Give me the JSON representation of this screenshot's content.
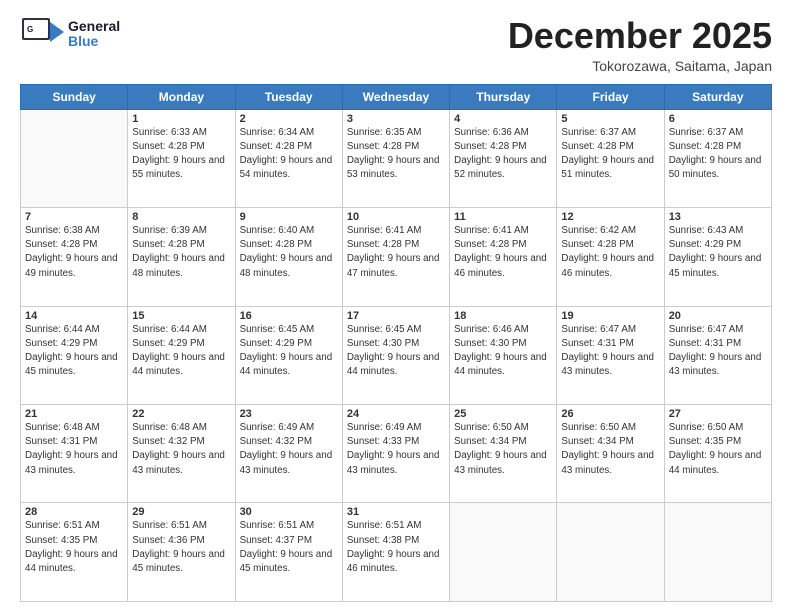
{
  "header": {
    "logo_general": "General",
    "logo_blue": "Blue",
    "month_title": "December 2025",
    "location": "Tokorozawa, Saitama, Japan"
  },
  "days_of_week": [
    "Sunday",
    "Monday",
    "Tuesday",
    "Wednesday",
    "Thursday",
    "Friday",
    "Saturday"
  ],
  "weeks": [
    [
      {
        "day": "",
        "empty": true
      },
      {
        "day": "1",
        "sunrise": "6:33 AM",
        "sunset": "4:28 PM",
        "daylight": "9 hours and 55 minutes."
      },
      {
        "day": "2",
        "sunrise": "6:34 AM",
        "sunset": "4:28 PM",
        "daylight": "9 hours and 54 minutes."
      },
      {
        "day": "3",
        "sunrise": "6:35 AM",
        "sunset": "4:28 PM",
        "daylight": "9 hours and 53 minutes."
      },
      {
        "day": "4",
        "sunrise": "6:36 AM",
        "sunset": "4:28 PM",
        "daylight": "9 hours and 52 minutes."
      },
      {
        "day": "5",
        "sunrise": "6:37 AM",
        "sunset": "4:28 PM",
        "daylight": "9 hours and 51 minutes."
      },
      {
        "day": "6",
        "sunrise": "6:37 AM",
        "sunset": "4:28 PM",
        "daylight": "9 hours and 50 minutes."
      }
    ],
    [
      {
        "day": "7",
        "sunrise": "6:38 AM",
        "sunset": "4:28 PM",
        "daylight": "9 hours and 49 minutes."
      },
      {
        "day": "8",
        "sunrise": "6:39 AM",
        "sunset": "4:28 PM",
        "daylight": "9 hours and 48 minutes."
      },
      {
        "day": "9",
        "sunrise": "6:40 AM",
        "sunset": "4:28 PM",
        "daylight": "9 hours and 48 minutes."
      },
      {
        "day": "10",
        "sunrise": "6:41 AM",
        "sunset": "4:28 PM",
        "daylight": "9 hours and 47 minutes."
      },
      {
        "day": "11",
        "sunrise": "6:41 AM",
        "sunset": "4:28 PM",
        "daylight": "9 hours and 46 minutes."
      },
      {
        "day": "12",
        "sunrise": "6:42 AM",
        "sunset": "4:28 PM",
        "daylight": "9 hours and 46 minutes."
      },
      {
        "day": "13",
        "sunrise": "6:43 AM",
        "sunset": "4:29 PM",
        "daylight": "9 hours and 45 minutes."
      }
    ],
    [
      {
        "day": "14",
        "sunrise": "6:44 AM",
        "sunset": "4:29 PM",
        "daylight": "9 hours and 45 minutes."
      },
      {
        "day": "15",
        "sunrise": "6:44 AM",
        "sunset": "4:29 PM",
        "daylight": "9 hours and 44 minutes."
      },
      {
        "day": "16",
        "sunrise": "6:45 AM",
        "sunset": "4:29 PM",
        "daylight": "9 hours and 44 minutes."
      },
      {
        "day": "17",
        "sunrise": "6:45 AM",
        "sunset": "4:30 PM",
        "daylight": "9 hours and 44 minutes."
      },
      {
        "day": "18",
        "sunrise": "6:46 AM",
        "sunset": "4:30 PM",
        "daylight": "9 hours and 44 minutes."
      },
      {
        "day": "19",
        "sunrise": "6:47 AM",
        "sunset": "4:31 PM",
        "daylight": "9 hours and 43 minutes."
      },
      {
        "day": "20",
        "sunrise": "6:47 AM",
        "sunset": "4:31 PM",
        "daylight": "9 hours and 43 minutes."
      }
    ],
    [
      {
        "day": "21",
        "sunrise": "6:48 AM",
        "sunset": "4:31 PM",
        "daylight": "9 hours and 43 minutes."
      },
      {
        "day": "22",
        "sunrise": "6:48 AM",
        "sunset": "4:32 PM",
        "daylight": "9 hours and 43 minutes."
      },
      {
        "day": "23",
        "sunrise": "6:49 AM",
        "sunset": "4:32 PM",
        "daylight": "9 hours and 43 minutes."
      },
      {
        "day": "24",
        "sunrise": "6:49 AM",
        "sunset": "4:33 PM",
        "daylight": "9 hours and 43 minutes."
      },
      {
        "day": "25",
        "sunrise": "6:50 AM",
        "sunset": "4:34 PM",
        "daylight": "9 hours and 43 minutes."
      },
      {
        "day": "26",
        "sunrise": "6:50 AM",
        "sunset": "4:34 PM",
        "daylight": "9 hours and 43 minutes."
      },
      {
        "day": "27",
        "sunrise": "6:50 AM",
        "sunset": "4:35 PM",
        "daylight": "9 hours and 44 minutes."
      }
    ],
    [
      {
        "day": "28",
        "sunrise": "6:51 AM",
        "sunset": "4:35 PM",
        "daylight": "9 hours and 44 minutes."
      },
      {
        "day": "29",
        "sunrise": "6:51 AM",
        "sunset": "4:36 PM",
        "daylight": "9 hours and 45 minutes."
      },
      {
        "day": "30",
        "sunrise": "6:51 AM",
        "sunset": "4:37 PM",
        "daylight": "9 hours and 45 minutes."
      },
      {
        "day": "31",
        "sunrise": "6:51 AM",
        "sunset": "4:38 PM",
        "daylight": "9 hours and 46 minutes."
      },
      {
        "day": "",
        "empty": true
      },
      {
        "day": "",
        "empty": true
      },
      {
        "day": "",
        "empty": true
      }
    ]
  ],
  "labels": {
    "sunrise": "Sunrise:",
    "sunset": "Sunset:",
    "daylight": "Daylight:"
  }
}
